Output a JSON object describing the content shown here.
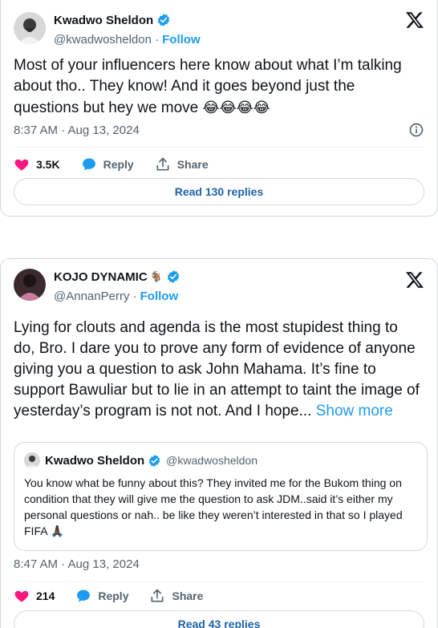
{
  "tweet1": {
    "author": {
      "name": "Kwadwo Sheldon",
      "handle": "@kwadwosheldon",
      "verified": true
    },
    "follow_label": "Follow",
    "text": "Most of your influencers here know about what I’m talking about tho.. They know! And it goes beyond just the questions but hey we move",
    "emojis": "😂😂😂😂",
    "timestamp": "8:37 AM · Aug 13, 2024",
    "likes": "3.5K",
    "reply_label": "Reply",
    "share_label": "Share",
    "read_replies": "Read 130 replies"
  },
  "tweet2": {
    "author": {
      "name": "KOJO DYNAMIC",
      "name_emoji": "🐐",
      "handle": "@AnnanPerry",
      "verified": true
    },
    "follow_label": "Follow",
    "text": "Lying for clouts and agenda is the most stupidest thing to do, Bro. I dare you to prove any form of evidence of anyone giving you a question to ask John Mahama. It’s fine to support Bawuliar but to lie in an attempt to taint the image of yesterday’s program is not not. And I hope...",
    "show_more": "Show more",
    "quote": {
      "name": "Kwadwo Sheldon",
      "handle": "@kwadwosheldon",
      "text": "You know what be funny about this? They invited me for the Bukom thing on condition that they will give me the question to ask JDM..said it’s either my personal questions or nah.. be like they weren’t interested in that so I played FIFA",
      "emoji": "🙏🏿"
    },
    "timestamp": "8:47 AM · Aug 13, 2024",
    "likes": "214",
    "reply_label": "Reply",
    "share_label": "Share",
    "read_replies": "Read 43 replies"
  },
  "colors": {
    "accent": "#1d9bf0",
    "like": "#f91880",
    "muted": "#536471",
    "border": "#cfd9de"
  },
  "icons": [
    "x-logo-icon",
    "verified-badge-icon",
    "heart-icon",
    "reply-bubble-icon",
    "share-icon",
    "info-icon"
  ]
}
